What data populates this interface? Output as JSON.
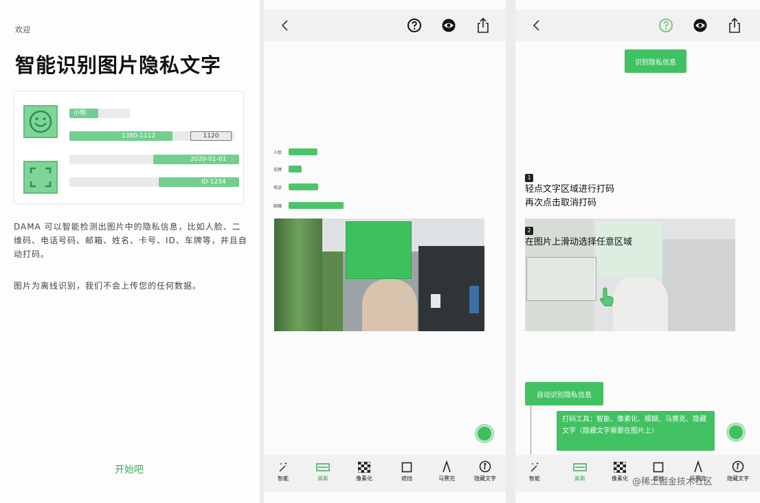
{
  "colors": {
    "accent": "#42c163",
    "accent_light": "#7fd49a",
    "text": "#1a1a1a"
  },
  "intro": {
    "eyebrow": "欢迎",
    "title": "智能识别图片隐私文字",
    "card": {
      "face_icon": "smiley-icon",
      "scan_icon": "scan-frame-icon",
      "bar1_text": "小明",
      "bar2_text": "1380-1112",
      "bar2_tag": "1120",
      "bar3_text": "2020-01-01",
      "bar4_text": "ID-1234"
    },
    "paragraph1": "DAMA 可以智能检测出图片中的隐私信息，比如人脸、二维码、电话号码、邮箱、姓名、卡号、ID、车牌等，并且自动打码。",
    "paragraph2": "图片为离线识别，我们不会上传您的任何数据。",
    "start_label": "开始吧"
  },
  "editor": {
    "nav_icons": [
      "back-icon",
      "help-icon",
      "preview-eye-icon",
      "share-icon"
    ],
    "stats": [
      {
        "label": "人脸",
        "value": 0.52
      },
      {
        "label": "车牌",
        "value": 0.24
      },
      {
        "label": "电话",
        "value": 0.54
      },
      {
        "label": "邮箱",
        "value": 1.0
      }
    ],
    "tools": [
      {
        "icon": "magic-wand-icon",
        "label": "智能"
      },
      {
        "icon": "blur-icon",
        "label": "高斯"
      },
      {
        "icon": "mosaic-icon",
        "label": "像素化"
      },
      {
        "icon": "box-icon",
        "label": "遮挡"
      },
      {
        "icon": "pen-icon",
        "label": "马赛克"
      },
      {
        "icon": "text-privacy-icon",
        "label": "隐藏文字"
      }
    ],
    "active_tool": 1
  },
  "tutorial": {
    "top_button": "识别隐私信息",
    "step1_num": "1",
    "step1_line1": "轻点文字区域进行打码",
    "step1_line2": "再次点击取消打码",
    "step2_num": "2",
    "step2_line1": "在图片上滑动选择任意区域",
    "auto_button": "自动识别隐私信息",
    "tooltip": "打码工具：智能、像素化、模糊、马赛克、隐藏文字（隐藏文字需要在图片上）",
    "tools": [
      {
        "icon": "magic-wand-icon",
        "label": "智能"
      },
      {
        "icon": "blur-icon",
        "label": "高斯"
      },
      {
        "icon": "mosaic-icon",
        "label": "像素化"
      },
      {
        "icon": "box-icon",
        "label": "遮挡"
      },
      {
        "icon": "pen-icon",
        "label": "马赛克"
      },
      {
        "icon": "text-privacy-icon",
        "label": "隐藏文字"
      }
    ],
    "active_tool": 1
  },
  "watermark": "@稀土掘金技术社区"
}
